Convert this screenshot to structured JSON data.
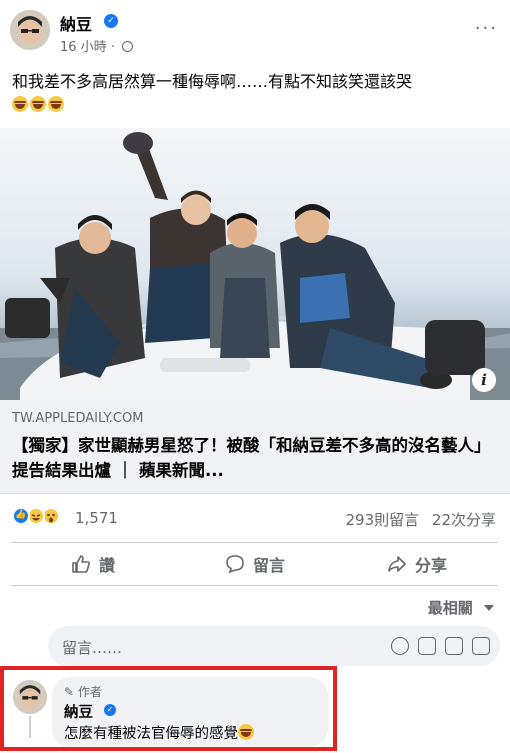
{
  "post": {
    "author": "納豆",
    "time": "16 小時",
    "separator": "·",
    "text": "和我差不多高居然算一種侮辱啊……有點不知該笑還該哭"
  },
  "link": {
    "domain": "TW.APPLEDAILY.COM",
    "title": "【獨家】家世顯赫男星怒了！被酸「和納豆差不多高的沒名藝人」　提告結果出爐 ｜ 蘋果新聞..."
  },
  "stats": {
    "reactions": "1,571",
    "comments": "293則留言",
    "shares": "22次分享"
  },
  "actions": {
    "like": "讚",
    "comment": "留言",
    "share": "分享"
  },
  "sort": {
    "label": "最相關"
  },
  "comment_box": {
    "placeholder": "留言……"
  },
  "comment": {
    "badge": "作者",
    "author": "納豆",
    "text": "怎麼有種被法官侮辱的感覺"
  },
  "colors": {
    "facebook_blue": "#1877f2",
    "highlight_red": "#e02424"
  }
}
